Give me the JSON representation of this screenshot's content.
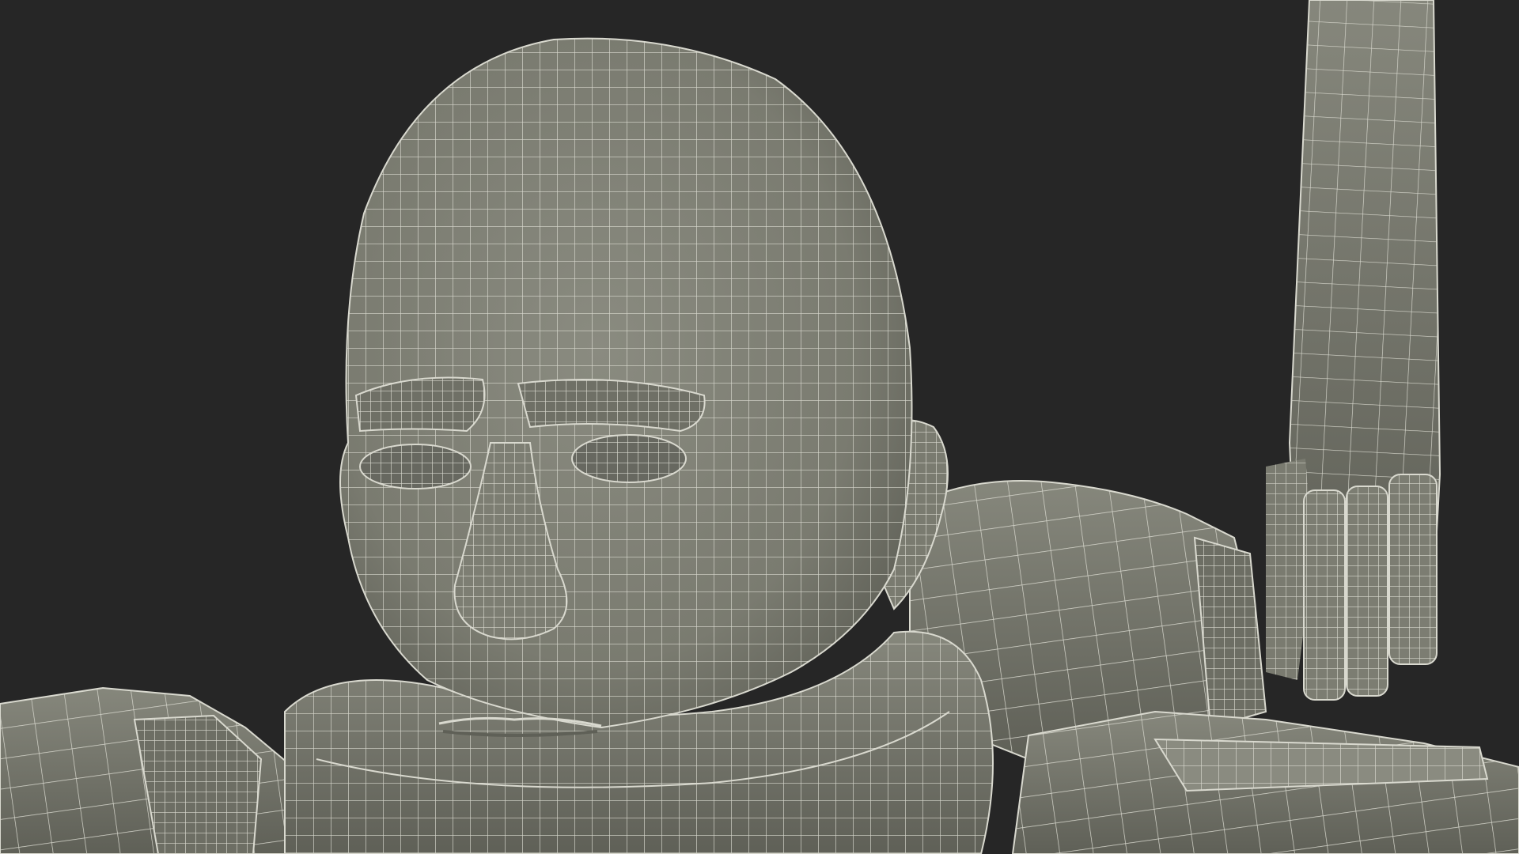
{
  "scene": {
    "colors": {
      "background": "#262626",
      "surface": "#7c7d72",
      "surface_shadow": "#5f6057",
      "surface_light": "#8d8e83",
      "wire": "#d9d9cf"
    }
  }
}
